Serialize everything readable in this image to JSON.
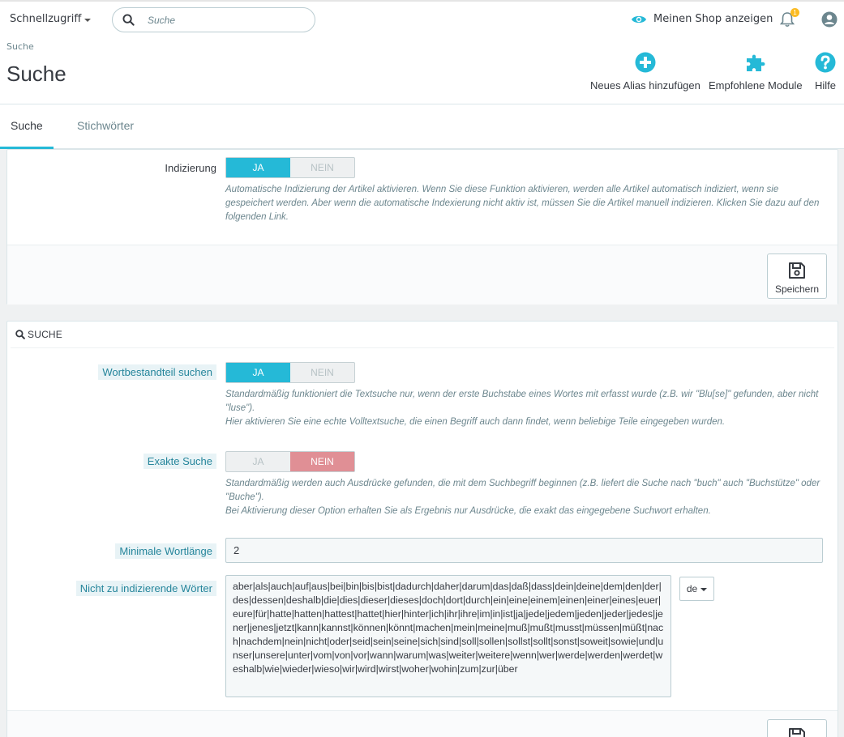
{
  "header": {
    "quick_access": "Schnellzugriff",
    "search_placeholder": "Suche",
    "view_shop": "Meinen Shop anzeigen",
    "notification_count": "1"
  },
  "page": {
    "breadcrumb": "Suche",
    "title": "Suche",
    "toolbar": [
      {
        "label": "Neues Alias hinzufügen",
        "icon": "add-circle-icon"
      },
      {
        "label": "Empfohlene Module",
        "icon": "puzzle-icon"
      },
      {
        "label": "Hilfe",
        "icon": "help-icon"
      }
    ]
  },
  "tabs": [
    "Suche",
    "Stichwörter"
  ],
  "indexing": {
    "label": "Indizierung",
    "yes": "JA",
    "no": "NEIN",
    "value": "JA",
    "help": "Automatische Indizierung der Artikel aktivieren. Wenn Sie diese Funktion aktivieren, werden alle Artikel automatisch indiziert, wenn sie gespeichert werden. Aber wenn die automatische Indexierung nicht aktiv ist, müssen Sie die Artikel manuell indizieren. Klicken Sie dazu auf den folgenden Link.",
    "save": "Speichern"
  },
  "search_panel": {
    "heading": "SUCHE",
    "partial": {
      "label": "Wortbestandteil suchen",
      "yes": "JA",
      "no": "NEIN",
      "value": "JA",
      "help1": "Standardmäßig funktioniert die Textsuche nur, wenn der erste Buchstabe eines Wortes mit erfasst wurde (z.B. wir \"Blu[se]\" gefunden, aber nicht \"luse\").",
      "help2": "Hier aktivieren Sie eine echte Volltextsuche, die einen Begriff auch dann findet, wenn beliebige Teile eingegeben wurden."
    },
    "exact": {
      "label": "Exakte Suche",
      "yes": "JA",
      "no": "NEIN",
      "value": "NEIN",
      "help1": "Standardmäßig werden auch Ausdrücke gefunden, die mit dem Suchbegriff beginnen (z.B. liefert die Suche nach \"buch\" auch \"Buchstütze\" oder \"Buche\").",
      "help2": "Bei Aktivierung dieser Option erhalten Sie als Ergebnis nur Ausdrücke, die exakt das eingegebene Suchwort erhalten."
    },
    "min_length": {
      "label": "Minimale Wortlänge",
      "value": "2"
    },
    "blacklist": {
      "label": "Nicht zu indizierende Wörter",
      "value": "aber|als|auch|auf|aus|bei|bin|bis|bist|dadurch|daher|darum|das|daß|dass|dein|deine|dem|den|der|des|dessen|deshalb|die|dies|dieser|dieses|doch|dort|durch|ein|eine|einem|einen|einer|eines|euer|eure|für|hatte|hatten|hattest|hattet|hier|hinter|ich|ihr|ihre|im|in|ist|ja|jede|jedem|jeden|jeder|jedes|jener|jenes|jetzt|kann|kannst|können|könnt|machen|mein|meine|muß|mußt|musst|müssen|müßt|nach|nachdem|nein|nicht|oder|seid|sein|seine|sich|sind|soll|sollen|sollst|sollt|sonst|soweit|sowie|und|unser|unsere|unter|vom|von|vor|wann|warum|was|weiter|weitere|wenn|wer|werde|werden|werdet|weshalb|wie|wieder|wieso|wir|wird|wirst|woher|wohin|zum|zur|über",
      "lang": "de"
    }
  },
  "colors": {
    "accent": "#25b9d7",
    "danger": "#e08f95",
    "badge": "#fbbb22"
  }
}
